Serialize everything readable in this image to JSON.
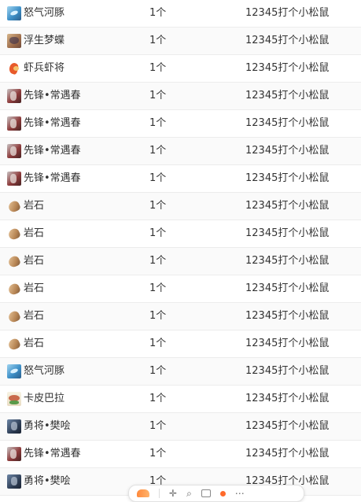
{
  "rows": [
    {
      "icon": "dolphin-icon",
      "name": "怒气河豚",
      "count": "1个",
      "user": "12345打个小松鼠"
    },
    {
      "icon": "butterfly-icon",
      "name": "浮生梦蝶",
      "count": "1个",
      "user": "12345打个小松鼠"
    },
    {
      "icon": "shrimp-soldier-icon",
      "name": "虾兵虾将",
      "count": "1个",
      "user": "12345打个小松鼠"
    },
    {
      "icon": "vanguard-icon",
      "name": "先锋•常遇春",
      "count": "1个",
      "user": "12345打个小松鼠"
    },
    {
      "icon": "vanguard-icon",
      "name": "先锋•常遇春",
      "count": "1个",
      "user": "12345打个小松鼠"
    },
    {
      "icon": "vanguard-icon",
      "name": "先锋•常遇春",
      "count": "1个",
      "user": "12345打个小松鼠"
    },
    {
      "icon": "vanguard-icon",
      "name": "先锋•常遇春",
      "count": "1个",
      "user": "12345打个小松鼠"
    },
    {
      "icon": "rock-icon",
      "name": "岩石",
      "count": "1个",
      "user": "12345打个小松鼠"
    },
    {
      "icon": "rock-icon",
      "name": "岩石",
      "count": "1个",
      "user": "12345打个小松鼠"
    },
    {
      "icon": "rock-icon",
      "name": "岩石",
      "count": "1个",
      "user": "12345打个小松鼠"
    },
    {
      "icon": "rock-icon",
      "name": "岩石",
      "count": "1个",
      "user": "12345打个小松鼠"
    },
    {
      "icon": "rock-icon",
      "name": "岩石",
      "count": "1个",
      "user": "12345打个小松鼠"
    },
    {
      "icon": "rock-icon",
      "name": "岩石",
      "count": "1个",
      "user": "12345打个小松鼠"
    },
    {
      "icon": "dolphin-icon",
      "name": "怒气河豚",
      "count": "1个",
      "user": "12345打个小松鼠"
    },
    {
      "icon": "capybara-icon",
      "name": "卡皮巴拉",
      "count": "1个",
      "user": "12345打个小松鼠"
    },
    {
      "icon": "general-icon",
      "name": "勇将•樊哙",
      "count": "1个",
      "user": "12345打个小松鼠"
    },
    {
      "icon": "vanguard-icon",
      "name": "先锋•常遇春",
      "count": "1个",
      "user": "12345打个小松鼠"
    },
    {
      "icon": "general-icon",
      "name": "勇将•樊哙",
      "count": "1个",
      "user": "12345打个小松鼠"
    }
  ],
  "toolbar": {
    "icons": [
      "logo-icon",
      "cursor-icon",
      "search-icon",
      "window-icon",
      "notification-dot-icon",
      "more-icon"
    ]
  },
  "colors": {
    "text": "#333333",
    "row_border": "#ececec",
    "accent": "#ff6a2b"
  }
}
